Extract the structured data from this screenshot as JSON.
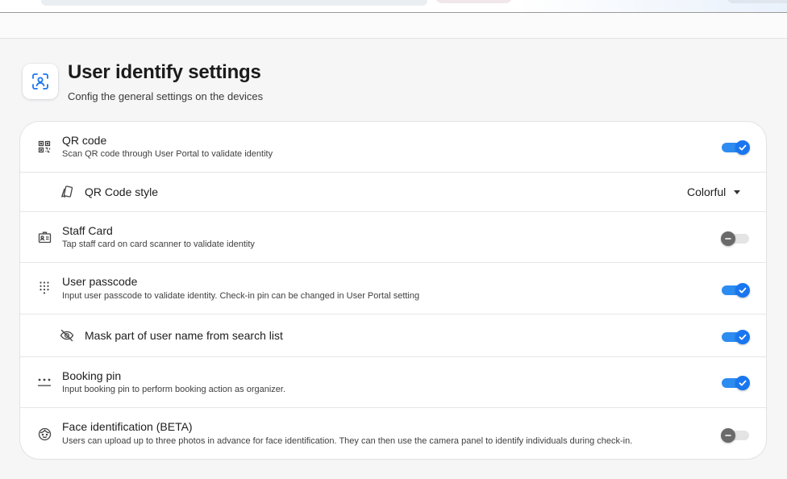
{
  "header": {
    "icon": "user-scan-icon",
    "title": "User identify settings",
    "subtitle": "Config the general settings on the devices"
  },
  "colors": {
    "accent": "#1976f0",
    "track_on": "#2d8cf0",
    "track_off": "#e4e4e4",
    "knob_off": "#6a6a6a"
  },
  "settings": {
    "qr_code": {
      "icon": "qr-code-icon",
      "title": "QR code",
      "description": "Scan QR code through User Portal to validate identity",
      "enabled": true
    },
    "qr_code_style": {
      "icon": "style-cards-icon",
      "title": "QR Code style",
      "selected": "Colorful"
    },
    "staff_card": {
      "icon": "id-card-icon",
      "title": "Staff Card",
      "description": "Tap staff card on card scanner to validate identity",
      "enabled": false
    },
    "user_passcode": {
      "icon": "keypad-icon",
      "title": "User passcode",
      "description": "Input user passcode to validate identity. Check-in pin can be changed in User Portal setting",
      "enabled": true
    },
    "mask_user_name": {
      "icon": "eye-off-icon",
      "title": "Mask part of user name from search list",
      "enabled": true
    },
    "booking_pin": {
      "icon": "pin-dots-icon",
      "title": "Booking pin",
      "description": "Input booking pin to perform booking action as organizer.",
      "enabled": true
    },
    "face_identification": {
      "icon": "face-icon",
      "title": "Face identification (BETA)",
      "description": "Users can upload up to three photos in advance for face identification. They can then use the camera panel to identify individuals during check-in.",
      "enabled": false
    }
  }
}
